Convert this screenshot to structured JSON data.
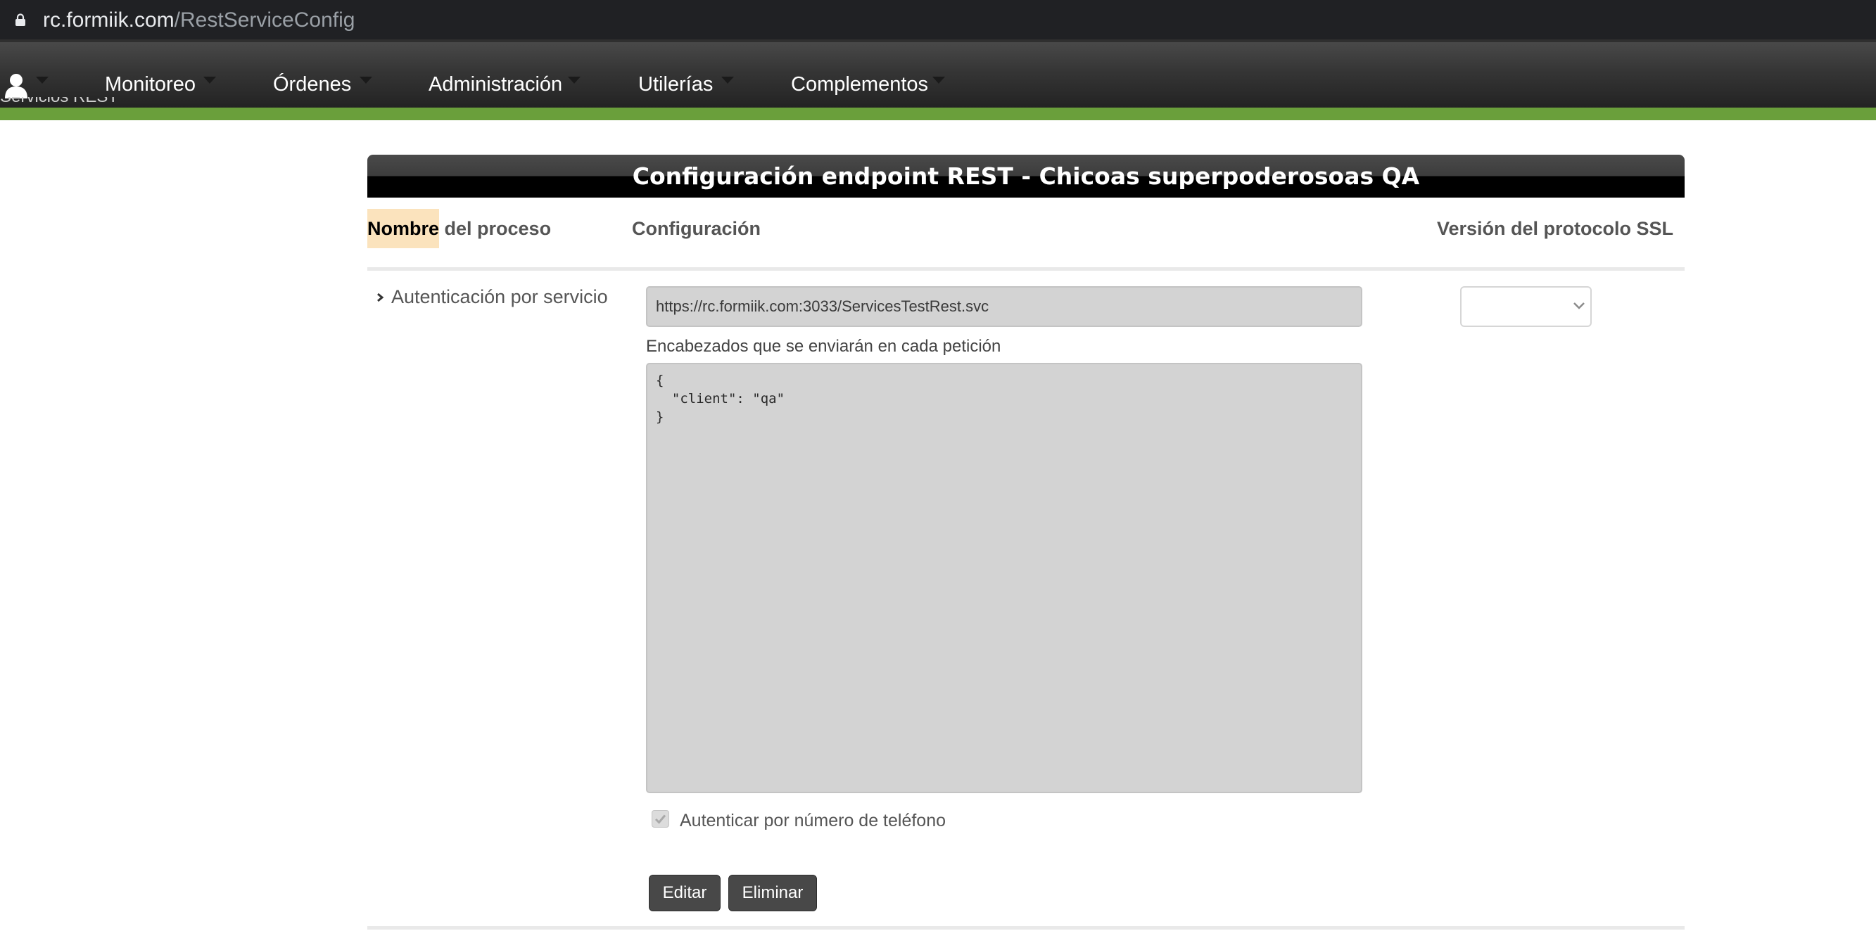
{
  "browser": {
    "url_host": "rc.formiik.com",
    "url_path": "/RestServiceConfig",
    "icon": "lock-icon"
  },
  "nav": {
    "user_icon": "user-icon",
    "items": [
      {
        "label": "Monitoreo"
      },
      {
        "label": "Órdenes"
      },
      {
        "label": "Administración"
      },
      {
        "label": "Utilerías"
      },
      {
        "label": "Complementos"
      }
    ],
    "breadcrumb_peek": "Servicios REST",
    "accent_color": "#6a9f3b"
  },
  "panel": {
    "title": "Configuración endpoint REST - Chicoas superpoderosoas QA",
    "columns": {
      "name_highlight": "Nombre",
      "name_rest": " del proceso",
      "config": "Configuración",
      "ssl": "Versión del protocolo SSL"
    },
    "row": {
      "process_name": "Autenticación por servicio",
      "url_value": "https://rc.formiik.com:3033/ServicesTestRest.svc",
      "headers_label": "Encabezados que se enviarán en cada petición",
      "headers_value": "{\n  \"client\": \"qa\"\n}",
      "ssl_selected": "",
      "phone_auth_label": "Autenticar por número de teléfono",
      "phone_auth_checked": true,
      "edit_label": "Editar",
      "delete_label": "Eliminar"
    }
  }
}
